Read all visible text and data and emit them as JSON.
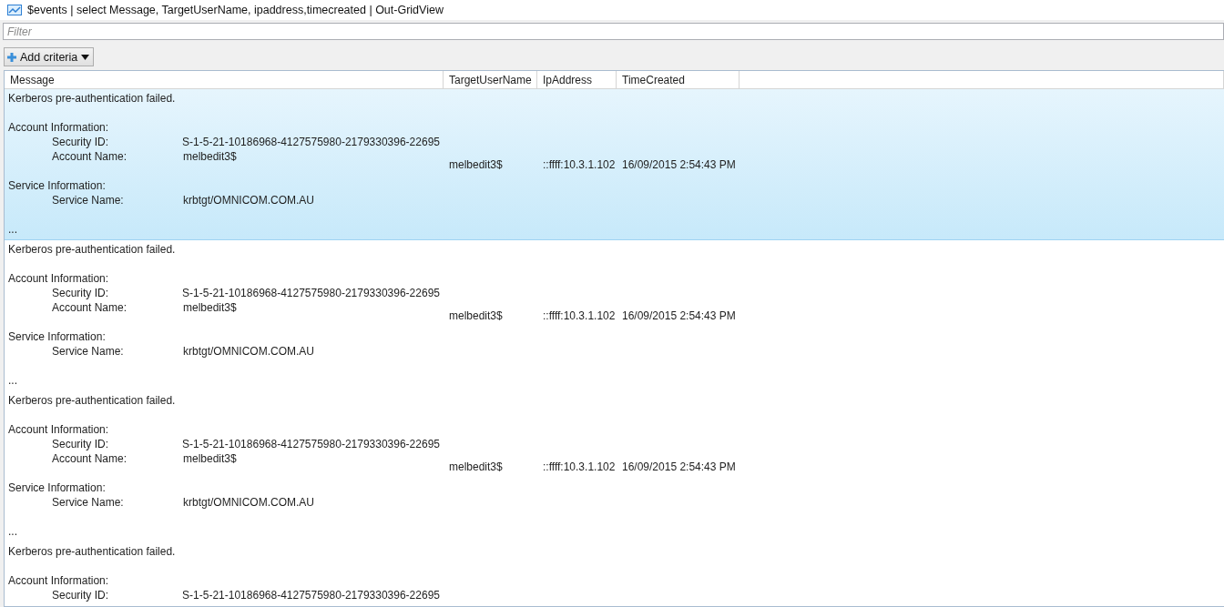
{
  "window": {
    "title": "$events | select Message, TargetUserName, ipaddress,timecreated | Out-GridView"
  },
  "filter": {
    "placeholder": "Filter"
  },
  "add_criteria": {
    "label": "Add criteria"
  },
  "table": {
    "columns": [
      "Message",
      "TargetUserName",
      "IpAddress",
      "TimeCreated"
    ],
    "rows": [
      {
        "selected": true,
        "message": {
          "title": "Kerberos pre-authentication failed.",
          "sections": [
            {
              "heading": "Account Information:",
              "fields": [
                {
                  "label": "Security ID:",
                  "value": "S-1-5-21-10186968-4127575980-2179330396-22695"
                },
                {
                  "label": "Account Name:",
                  "value": "melbedit3$"
                }
              ]
            },
            {
              "heading": "Service Information:",
              "fields": [
                {
                  "label": "Service Name:",
                  "value": "krbtgt/OMNICOM.COM.AU"
                }
              ]
            }
          ],
          "ellipsis": "..."
        },
        "target_user_name": "melbedit3$",
        "ip_address": "::ffff:10.3.1.102",
        "time_created": "16/09/2015 2:54:43 PM"
      },
      {
        "selected": false,
        "message": {
          "title": "Kerberos pre-authentication failed.",
          "sections": [
            {
              "heading": "Account Information:",
              "fields": [
                {
                  "label": "Security ID:",
                  "value": "S-1-5-21-10186968-4127575980-2179330396-22695"
                },
                {
                  "label": "Account Name:",
                  "value": "melbedit3$"
                }
              ]
            },
            {
              "heading": "Service Information:",
              "fields": [
                {
                  "label": "Service Name:",
                  "value": "krbtgt/OMNICOM.COM.AU"
                }
              ]
            }
          ],
          "ellipsis": "..."
        },
        "target_user_name": "melbedit3$",
        "ip_address": "::ffff:10.3.1.102",
        "time_created": "16/09/2015 2:54:43 PM"
      },
      {
        "selected": false,
        "message": {
          "title": "Kerberos pre-authentication failed.",
          "sections": [
            {
              "heading": "Account Information:",
              "fields": [
                {
                  "label": "Security ID:",
                  "value": "S-1-5-21-10186968-4127575980-2179330396-22695"
                },
                {
                  "label": "Account Name:",
                  "value": "melbedit3$"
                }
              ]
            },
            {
              "heading": "Service Information:",
              "fields": [
                {
                  "label": "Service Name:",
                  "value": "krbtgt/OMNICOM.COM.AU"
                }
              ]
            }
          ],
          "ellipsis": "..."
        },
        "target_user_name": "melbedit3$",
        "ip_address": "::ffff:10.3.1.102",
        "time_created": "16/09/2015 2:54:43 PM"
      },
      {
        "selected": false,
        "message": {
          "title": "Kerberos pre-authentication failed.",
          "sections": [
            {
              "heading": "Account Information:",
              "fields": [
                {
                  "label": "Security ID:",
                  "value": "S-1-5-21-10186968-4127575980-2179330396-22695"
                }
              ]
            }
          ]
        }
      }
    ]
  }
}
